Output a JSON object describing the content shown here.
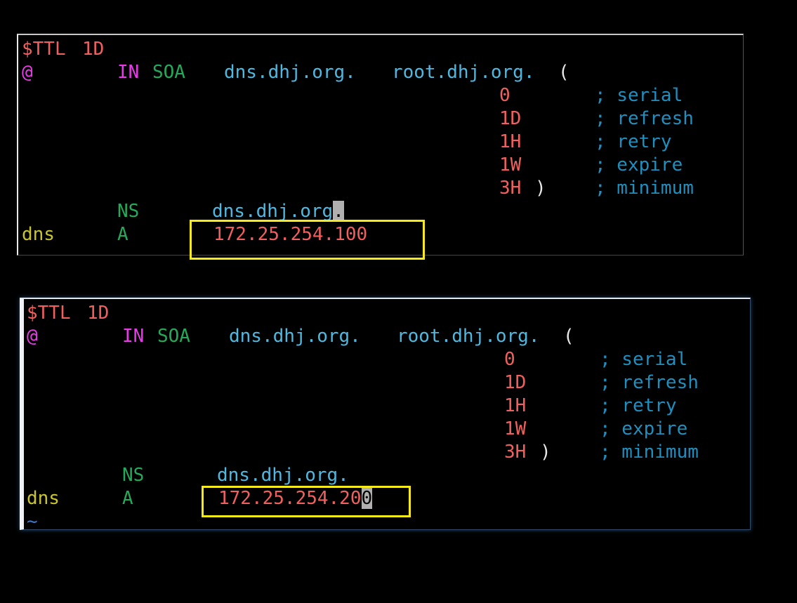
{
  "terminals": [
    {
      "ttl_directive": "$TTL",
      "ttl_value": "1D",
      "origin": "@",
      "class": "IN",
      "soa_type": "SOA",
      "primary_ns": "dns.dhj.org.",
      "admin_email": "root.dhj.org.",
      "open_paren": "(",
      "close_paren": ")",
      "timers": [
        {
          "value": "0",
          "comment": "; serial"
        },
        {
          "value": "1D",
          "comment": "; refresh"
        },
        {
          "value": "1H",
          "comment": "; retry"
        },
        {
          "value": "1W",
          "comment": "; expire"
        },
        {
          "value": "3H",
          "comment": "; minimum"
        }
      ],
      "ns_type": "NS",
      "ns_value_main": "dns.dhj.org",
      "ns_value_cursor": ".",
      "a_host": "dns",
      "a_type": "A",
      "a_ip_main": "172.25.254.100",
      "a_ip_cursor": ""
    },
    {
      "ttl_directive": "$TTL",
      "ttl_value": "1D",
      "origin": "@",
      "class": "IN",
      "soa_type": "SOA",
      "primary_ns": "dns.dhj.org.",
      "admin_email": "root.dhj.org.",
      "open_paren": "(",
      "close_paren": ")",
      "timers": [
        {
          "value": "0",
          "comment": "; serial"
        },
        {
          "value": "1D",
          "comment": "; refresh"
        },
        {
          "value": "1H",
          "comment": "; retry"
        },
        {
          "value": "1W",
          "comment": "; expire"
        },
        {
          "value": "3H",
          "comment": "; minimum"
        }
      ],
      "ns_type": "NS",
      "ns_value_main": "dns.dhj.org.",
      "ns_value_cursor": "",
      "a_host": "dns",
      "a_type": "A",
      "a_ip_main": "172.25.254.20",
      "a_ip_cursor": "0",
      "empty_line_marker": "~"
    }
  ],
  "colors": {
    "background": "#000000",
    "number": "#f0605f",
    "keyword": "#e83be8",
    "record_type": "#25a95a",
    "domain": "#4fb8e0",
    "comment": "#1f8fbf",
    "hostname": "#c9c531",
    "highlight_box": "#f7ea1a",
    "cursor": "#b0b0b0"
  }
}
